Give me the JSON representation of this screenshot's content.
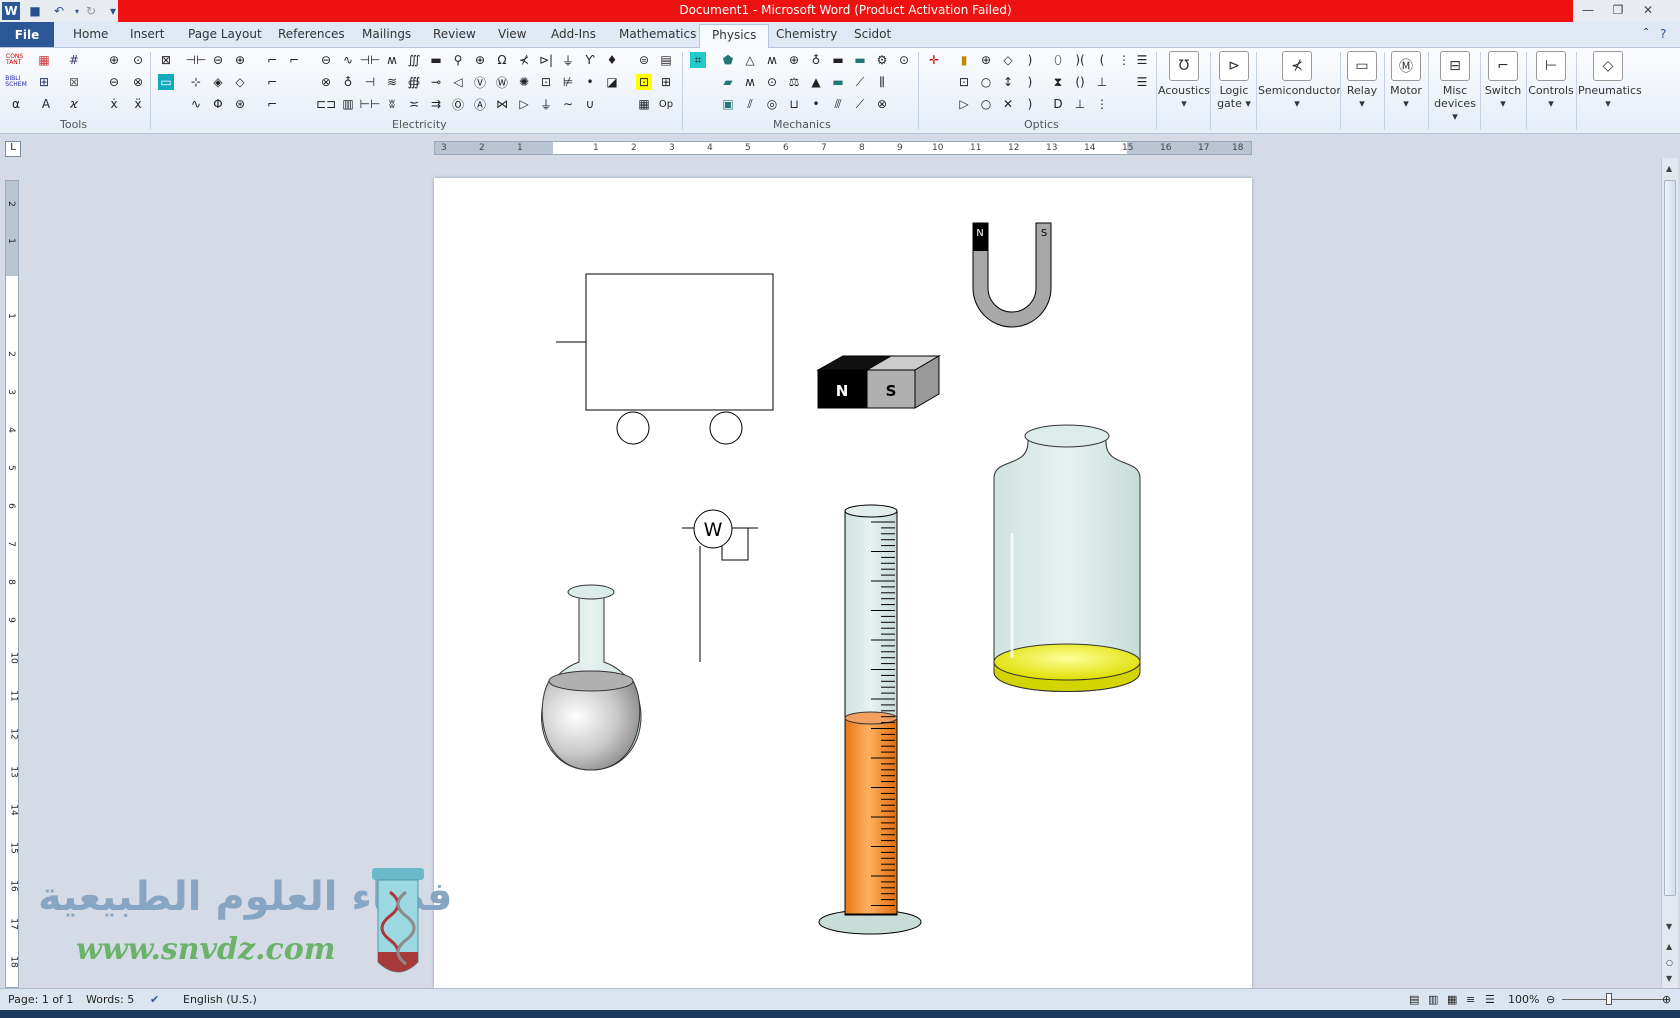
{
  "window": {
    "title": "Document1  -  Microsoft Word (Product Activation Failed)"
  },
  "tabs": [
    "File",
    "Home",
    "Insert",
    "Page Layout",
    "References",
    "Mailings",
    "Review",
    "View",
    "Add-Ins",
    "Mathematics",
    "Physics",
    "Chemistry",
    "Scidot"
  ],
  "active_tab": "Physics",
  "ribbon": {
    "groups": [
      "Tools",
      "Electricity",
      "Mechanics",
      "Optics"
    ],
    "tools_text": {
      "cons": "CONS TANT",
      "bibli": "BIBLI SCHEM",
      "alpha": "α",
      "a_letter": "A",
      "op": "Op"
    },
    "big_buttons": [
      "Acoustics",
      "Logic gate",
      "Semiconductor",
      "Relay",
      "Motor",
      "Misc devices",
      "Switch",
      "Controls",
      "Pneumatics"
    ]
  },
  "ruler": {
    "h_numbers": [
      "3",
      "2",
      "1",
      "1",
      "2",
      "3",
      "4",
      "5",
      "6",
      "7",
      "8",
      "9",
      "10",
      "11",
      "12",
      "13",
      "14",
      "15",
      "16",
      "17",
      "18"
    ],
    "v_numbers": [
      "2",
      "1",
      "1",
      "2",
      "3",
      "4",
      "5",
      "6",
      "7",
      "8",
      "9",
      "10",
      "11",
      "12",
      "13",
      "14",
      "15",
      "16",
      "17",
      "18"
    ]
  },
  "document": {
    "magnet_n": "N",
    "magnet_s": "S",
    "horseshoe_n": "N",
    "horseshoe_s": "S",
    "wattmeter": "W"
  },
  "watermark": {
    "arabic": "فضاء العلوم الطبيعية",
    "url": "www.snvdz.com"
  },
  "status": {
    "page": "Page: 1 of 1",
    "words": "Words: 5",
    "language": "English (U.S.)",
    "zoom": "100%"
  }
}
